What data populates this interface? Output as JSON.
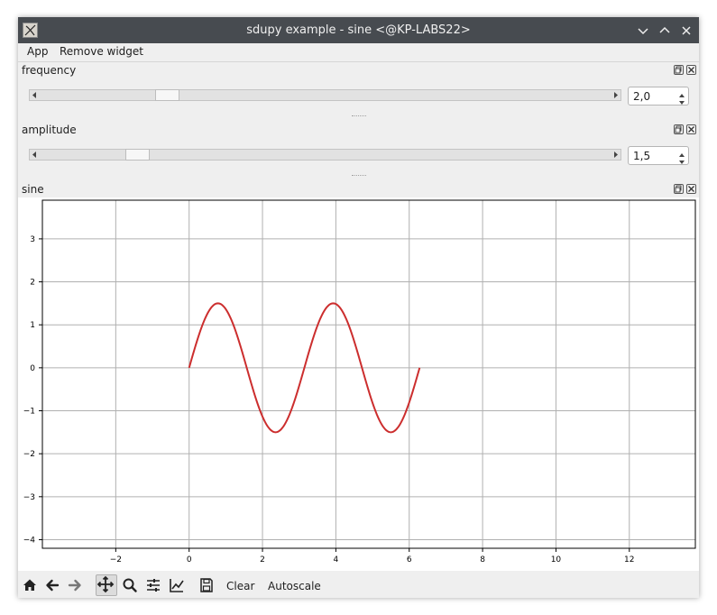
{
  "window": {
    "title": "sdupy example - sine <@KP-LABS22>"
  },
  "menu": {
    "app": "App",
    "remove_widget": "Remove widget"
  },
  "frequency": {
    "title": "frequency",
    "value": "2,0",
    "slider_fraction": 0.21
  },
  "amplitude": {
    "title": "amplitude",
    "value": "1,5",
    "slider_fraction": 0.155
  },
  "sine": {
    "title": "sine"
  },
  "toolbar": {
    "clear": "Clear",
    "autoscale": "Autoscale",
    "icons": [
      "home-icon",
      "back-arrow-icon",
      "forward-arrow-icon",
      "pan-icon",
      "zoom-icon",
      "subplots-icon",
      "edit-axes-icon",
      "save-icon"
    ]
  },
  "colors": {
    "line": "#cc2e2e",
    "titlebar": "#474b50",
    "grid": "#b0b0b0"
  },
  "chart_data": {
    "type": "line",
    "xlim": [
      -4.0,
      13.8
    ],
    "ylim": [
      -4.2,
      3.9
    ],
    "xticks": [
      -2,
      0,
      2,
      4,
      6,
      8,
      10,
      12
    ],
    "yticks": [
      -4,
      -3,
      -2,
      -1,
      0,
      1,
      2,
      3
    ],
    "grid": true,
    "series": [
      {
        "function": "1.5*sin(2.0*x)",
        "x_range": [
          0,
          6.2832
        ],
        "amplitude": 1.5,
        "frequency": 2.0
      }
    ]
  }
}
